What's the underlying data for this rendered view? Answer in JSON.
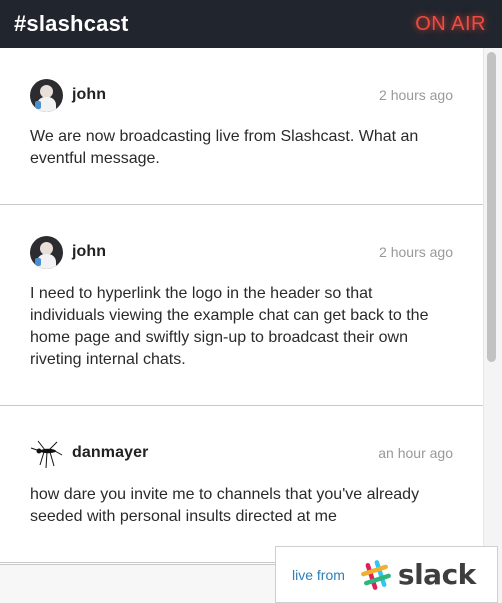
{
  "header": {
    "channel": "#slashcast",
    "status": "ON AIR"
  },
  "messages": [
    {
      "user": "john",
      "avatar": "john-avatar",
      "time": "2 hours ago",
      "text": "We are now broadcasting live from Slashcast. What an eventful message."
    },
    {
      "user": "john",
      "avatar": "john-avatar",
      "time": "2 hours ago",
      "text": "I need to hyperlink the logo in the header so that individuals viewing the example chat can get back to the home page and swiftly sign-up to broadcast their own riveting internal chats."
    },
    {
      "user": "danmayer",
      "avatar": "mosquito-avatar",
      "time": "an hour ago",
      "text": "how dare you invite me to channels that you've already seeded with personal insults directed at me"
    }
  ],
  "badge": {
    "live_from": "live from",
    "brand": "slack",
    "icon": "slack-hash-icon"
  },
  "colors": {
    "header_bg": "#21262e",
    "on_air": "#ef4b3f",
    "link": "#2d7fb8"
  }
}
